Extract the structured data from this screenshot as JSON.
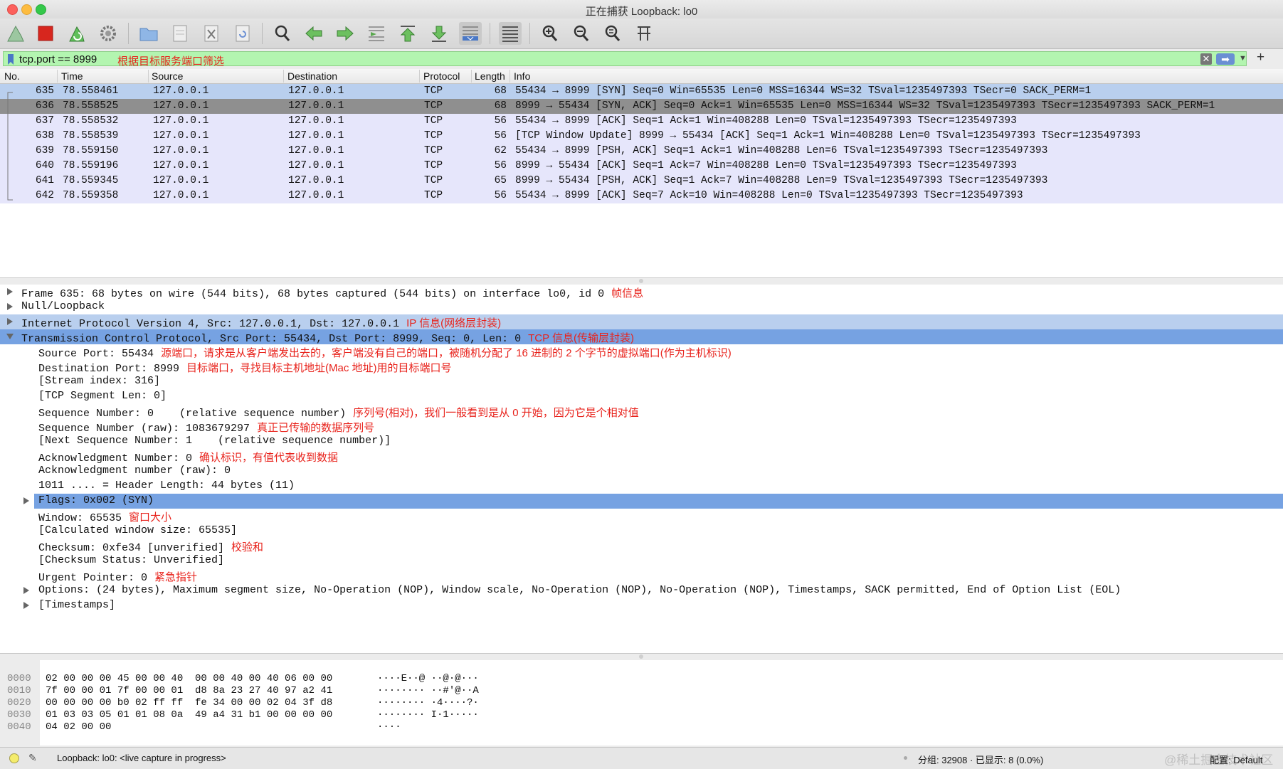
{
  "window": {
    "title": "正在捕获 Loopback: lo0"
  },
  "toolbar": {
    "icons": [
      "shark-fin-start-icon",
      "stop-icon",
      "restart-icon",
      "options-gear-icon",
      "open-folder-icon",
      "save-file-icon",
      "close-file-icon",
      "reload-icon",
      "find-icon",
      "back-arrow-icon",
      "forward-arrow-icon",
      "goto-packet-icon",
      "first-packet-icon",
      "last-packet-icon",
      "autoscroll-icon",
      "colorize-icon",
      "zoom-in-icon",
      "zoom-out-icon",
      "zoom-normal-icon",
      "resize-columns-icon"
    ]
  },
  "filter": {
    "value": "tcp.port == 8999",
    "note": "根据目标服务端口筛选"
  },
  "columns": [
    "No.",
    "Time",
    "Source",
    "Destination",
    "Protocol",
    "Length",
    "Info"
  ],
  "packets": [
    {
      "no": "635",
      "time": "78.558461",
      "src": "127.0.0.1",
      "dst": "127.0.0.1",
      "proto": "TCP",
      "len": "68",
      "info": "55434 → 8999 [SYN] Seq=0 Win=65535 Len=0 MSS=16344 WS=32 TSval=1235497393 TSecr=0 SACK_PERM=1"
    },
    {
      "no": "636",
      "time": "78.558525",
      "src": "127.0.0.1",
      "dst": "127.0.0.1",
      "proto": "TCP",
      "len": "68",
      "info": "8999 → 55434 [SYN, ACK] Seq=0 Ack=1 Win=65535 Len=0 MSS=16344 WS=32 TSval=1235497393 TSecr=1235497393 SACK_PERM=1"
    },
    {
      "no": "637",
      "time": "78.558532",
      "src": "127.0.0.1",
      "dst": "127.0.0.1",
      "proto": "TCP",
      "len": "56",
      "info": "55434 → 8999 [ACK] Seq=1 Ack=1 Win=408288 Len=0 TSval=1235497393 TSecr=1235497393"
    },
    {
      "no": "638",
      "time": "78.558539",
      "src": "127.0.0.1",
      "dst": "127.0.0.1",
      "proto": "TCP",
      "len": "56",
      "info": "[TCP Window Update] 8999 → 55434 [ACK] Seq=1 Ack=1 Win=408288 Len=0 TSval=1235497393 TSecr=1235497393"
    },
    {
      "no": "639",
      "time": "78.559150",
      "src": "127.0.0.1",
      "dst": "127.0.0.1",
      "proto": "TCP",
      "len": "62",
      "info": "55434 → 8999 [PSH, ACK] Seq=1 Ack=1 Win=408288 Len=6 TSval=1235497393 TSecr=1235497393"
    },
    {
      "no": "640",
      "time": "78.559196",
      "src": "127.0.0.1",
      "dst": "127.0.0.1",
      "proto": "TCP",
      "len": "56",
      "info": "8999 → 55434 [ACK] Seq=1 Ack=7 Win=408288 Len=0 TSval=1235497393 TSecr=1235497393"
    },
    {
      "no": "641",
      "time": "78.559345",
      "src": "127.0.0.1",
      "dst": "127.0.0.1",
      "proto": "TCP",
      "len": "65",
      "info": "8999 → 55434 [PSH, ACK] Seq=1 Ack=7 Win=408288 Len=9 TSval=1235497393 TSecr=1235497393"
    },
    {
      "no": "642",
      "time": "78.559358",
      "src": "127.0.0.1",
      "dst": "127.0.0.1",
      "proto": "TCP",
      "len": "56",
      "info": "55434 → 8999 [ACK] Seq=7 Ack=10 Win=408288 Len=0 TSval=1235497393 TSecr=1235497393"
    }
  ],
  "details": [
    {
      "text": "Frame 635: 68 bytes on wire (544 bits), 68 bytes captured (544 bits) on interface lo0, id 0",
      "note": "帧信息"
    },
    {
      "text": "Null/Loopback",
      "note": ""
    },
    {
      "text": "Internet Protocol Version 4, Src: 127.0.0.1, Dst: 127.0.0.1",
      "note": "IP 信息(网络层封装)"
    },
    {
      "text": "Transmission Control Protocol, Src Port: 55434, Dst Port: 8999, Seq: 0, Len: 0",
      "note": "TCP 信息(传输层封装)"
    },
    {
      "text": "Source Port: 55434",
      "note": "源端口，请求是从客户端发出去的，客户端没有自己的端口，被随机分配了 16 进制的 2 个字节的虚拟端口(作为主机标识)"
    },
    {
      "text": "Destination Port: 8999",
      "note": "目标端口，寻找目标主机地址(Mac 地址)用的目标端口号"
    },
    {
      "text": "[Stream index: 316]",
      "note": ""
    },
    {
      "text": "[TCP Segment Len: 0]",
      "note": ""
    },
    {
      "text": "Sequence Number: 0    (relative sequence number)",
      "note": "序列号(相对)，我们一般看到是从 0 开始，因为它是个相对值"
    },
    {
      "text": "Sequence Number (raw): 1083679297",
      "note": "真正已传输的数据序列号"
    },
    {
      "text": "[Next Sequence Number: 1    (relative sequence number)]",
      "note": ""
    },
    {
      "text": "Acknowledgment Number: 0",
      "note": "确认标识，有值代表收到数据"
    },
    {
      "text": "Acknowledgment number (raw): 0",
      "note": ""
    },
    {
      "text": "1011 .... = Header Length: 44 bytes (11)",
      "note": ""
    },
    {
      "text": "Flags: 0x002 (SYN)",
      "note": ""
    },
    {
      "text": "Window: 65535",
      "note": "窗口大小"
    },
    {
      "text": "[Calculated window size: 65535]",
      "note": ""
    },
    {
      "text": "Checksum: 0xfe34 [unverified]",
      "note": "校验和"
    },
    {
      "text": "[Checksum Status: Unverified]",
      "note": ""
    },
    {
      "text": "Urgent Pointer: 0",
      "note": "紧急指针"
    },
    {
      "text": "Options: (24 bytes), Maximum segment size, No-Operation (NOP), Window scale, No-Operation (NOP), No-Operation (NOP), Timestamps, SACK permitted, End of Option List (EOL)",
      "note": ""
    },
    {
      "text": "[Timestamps]",
      "note": ""
    }
  ],
  "hex": [
    {
      "off": "0000",
      "bytes": "02 00 00 00 45 00 00 40  00 00 40 00 40 06 00 00",
      "ascii": "····E··@ ··@·@···"
    },
    {
      "off": "0010",
      "bytes": "7f 00 00 01 7f 00 00 01  d8 8a 23 27 40 97 a2 41",
      "ascii": "········ ··#'@··A"
    },
    {
      "off": "0020",
      "bytes": "00 00 00 00 b0 02 ff ff  fe 34 00 00 02 04 3f d8",
      "ascii": "········ ·4····?·"
    },
    {
      "off": "0030",
      "bytes": "01 03 03 05 01 01 08 0a  49 a4 31 b1 00 00 00 00",
      "ascii": "········ I·1·····"
    },
    {
      "off": "0040",
      "bytes": "04 02 00 00",
      "ascii": "····"
    }
  ],
  "status": {
    "capture": "Loopback: lo0: <live capture in progress>",
    "stats": "分组: 32908 · 已显示: 8 (0.0%)",
    "profile": "配置: Default",
    "watermark": "@稀土掘金技术社区"
  },
  "colors": {
    "filter_bg": "#b3f5b0",
    "row_bg": "#e6e6fb",
    "row_highlight": "#b9cfee",
    "row_selected": "#8f8f8f",
    "detail_selected": "#76a2e2",
    "annotation": "#e8221b"
  }
}
